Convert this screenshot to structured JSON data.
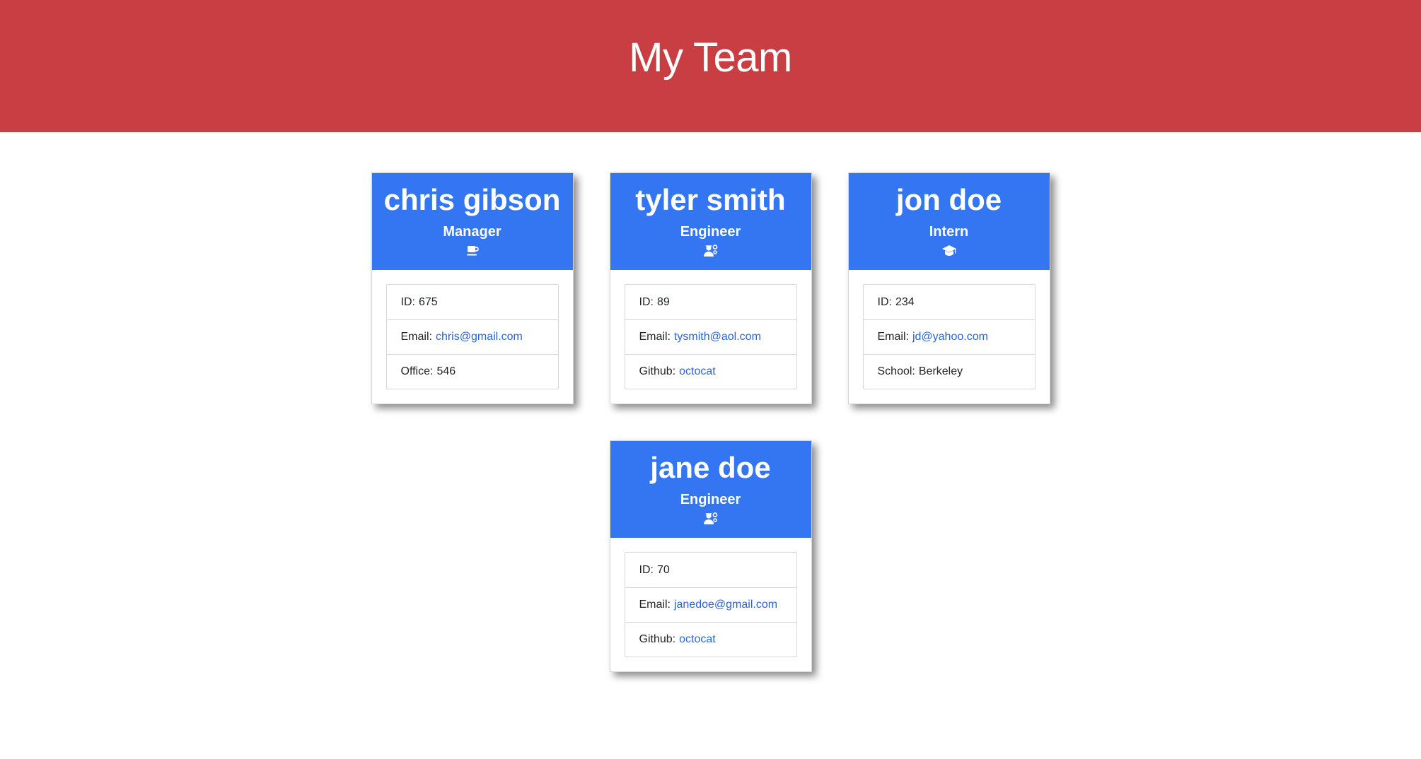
{
  "header": {
    "title": "My Team"
  },
  "colors": {
    "header_bg": "#c83e42",
    "card_header_bg": "#3476f1",
    "link": "#2a63d6"
  },
  "cards": [
    {
      "name": "chris gibson",
      "role": "Manager",
      "icon": "coffee-mug-icon",
      "id_label": "ID:",
      "id": "675",
      "email_label": "Email:",
      "email": "chris@gmail.com",
      "extra_label": "Office:",
      "extra": "546"
    },
    {
      "name": "tyler smith",
      "role": "Engineer",
      "icon": "user-gear-icon",
      "id_label": "ID:",
      "id": "89",
      "email_label": "Email:",
      "email": "tysmith@aol.com",
      "extra_label": "Github:",
      "extra": "octocat"
    },
    {
      "name": "jon doe",
      "role": "Intern",
      "icon": "graduation-cap-icon",
      "id_label": "ID:",
      "id": "234",
      "email_label": "Email:",
      "email": "jd@yahoo.com",
      "extra_label": "School:",
      "extra": "Berkeley"
    },
    {
      "name": "jane doe",
      "role": "Engineer",
      "icon": "user-gear-icon",
      "id_label": "ID:",
      "id": "70",
      "email_label": "Email:",
      "email": "janedoe@gmail.com",
      "extra_label": "Github:",
      "extra": "octocat"
    }
  ]
}
